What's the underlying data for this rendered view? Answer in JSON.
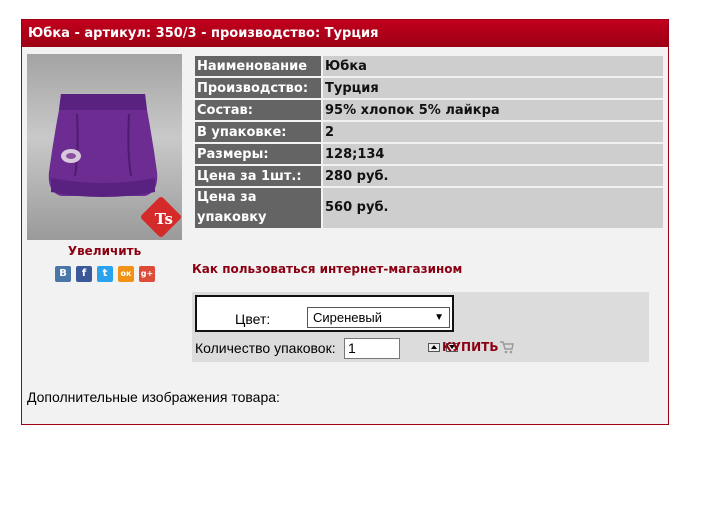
{
  "product": {
    "title": "Юбка - артикул: 350/3 - производство: Турция",
    "zoom_link": "Увеличить",
    "logo_text": "Ts",
    "specs": [
      {
        "label": "Наименование",
        "value": "Юбка"
      },
      {
        "label": "Производство:",
        "value": "Турция"
      },
      {
        "label": "Состав:",
        "value": "95% хлопок 5% лайкра"
      },
      {
        "label": "В упаковке:",
        "value": "2"
      },
      {
        "label": "Размеры:",
        "value": "128;134"
      },
      {
        "label": "Цена за 1шт.:",
        "value": "280 руб."
      },
      {
        "label": "Цена за упаковку",
        "value": "560 руб."
      }
    ],
    "howto_link": "Как пользоваться интернет-магазином",
    "extra_images_label": "Дополнительные изображения товара:"
  },
  "social": [
    {
      "icon": "vk-icon",
      "glyph": "В",
      "color": "#4a76a8"
    },
    {
      "icon": "facebook-icon",
      "glyph": "f",
      "color": "#3b5998"
    },
    {
      "icon": "twitter-icon",
      "glyph": "t",
      "color": "#2aa3ef"
    },
    {
      "icon": "odnoklassniki-icon",
      "glyph": "ок",
      "color": "#f29214"
    },
    {
      "icon": "google-plus-icon",
      "glyph": "g+",
      "color": "#dd4b39"
    }
  ],
  "order": {
    "color_label": "Цвет:",
    "color_selected": "Сиреневый",
    "qty_label": "Количество упаковок:",
    "qty_value": "1",
    "buy_label": "КУПИТЬ"
  },
  "colors": {
    "header_red": "#b0001a",
    "link_dark_red": "#8b0012",
    "label_cell_gray": "#646464",
    "value_cell_gray": "#cecece",
    "skirt_purple": "#6c2c92"
  }
}
